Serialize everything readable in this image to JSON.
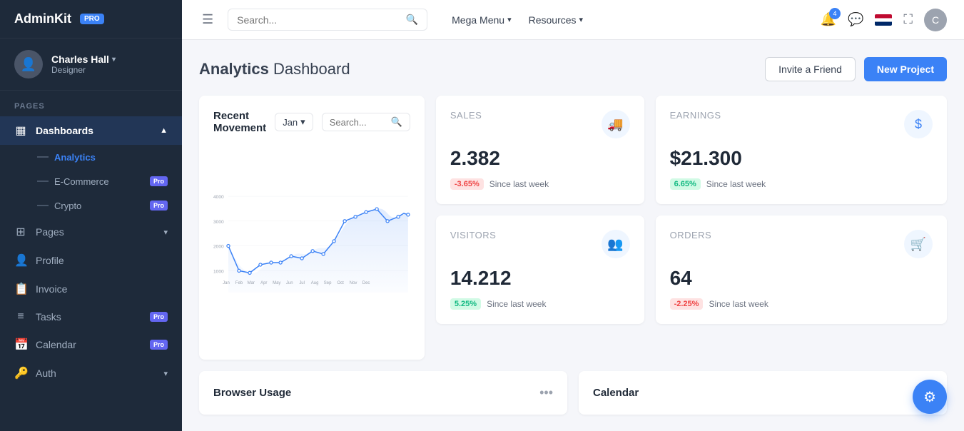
{
  "brand": {
    "name": "AdminKit",
    "badge": "PRO"
  },
  "user": {
    "name": "Charles Hall",
    "role": "Designer",
    "avatar_initial": "C"
  },
  "sidebar": {
    "pages_label": "Pages",
    "groups": [
      {
        "label": "Dashboards",
        "icon": "▦",
        "expanded": true,
        "sub_items": [
          {
            "label": "Analytics",
            "active": true,
            "pro": false
          },
          {
            "label": "E-Commerce",
            "active": false,
            "pro": true
          },
          {
            "label": "Crypto",
            "active": false,
            "pro": true
          }
        ]
      }
    ],
    "items": [
      {
        "label": "Pages",
        "icon": "⊞",
        "pro": false,
        "has_arrow": true
      },
      {
        "label": "Profile",
        "icon": "👤",
        "pro": false
      },
      {
        "label": "Invoice",
        "icon": "📋",
        "pro": false
      },
      {
        "label": "Tasks",
        "icon": "≡",
        "pro": true
      },
      {
        "label": "Calendar",
        "icon": "📅",
        "pro": true
      },
      {
        "label": "Auth",
        "icon": "🔑",
        "pro": false,
        "has_arrow": true
      }
    ]
  },
  "topbar": {
    "search_placeholder": "Search...",
    "mega_menu": "Mega Menu",
    "resources": "Resources",
    "notification_count": "4"
  },
  "page": {
    "title_strong": "Analytics",
    "title_rest": " Dashboard",
    "invite_button": "Invite a Friend",
    "new_project_button": "New Project"
  },
  "stats": {
    "sales": {
      "label": "Sales",
      "value": "2.382",
      "badge": "-3.65%",
      "badge_type": "neg",
      "since": "Since last week",
      "icon": "🚚"
    },
    "earnings": {
      "label": "Earnings",
      "value": "$21.300",
      "badge": "6.65%",
      "badge_type": "pos",
      "since": "Since last week",
      "icon": "$"
    },
    "visitors": {
      "label": "Visitors",
      "value": "14.212",
      "badge": "5.25%",
      "badge_type": "pos",
      "since": "Since last week",
      "icon": "👥"
    },
    "orders": {
      "label": "Orders",
      "value": "64",
      "badge": "-2.25%",
      "badge_type": "neg",
      "since": "Since last week",
      "icon": "🛒"
    }
  },
  "chart": {
    "title": "Recent Movement",
    "month": "Jan",
    "search_placeholder": "Search...",
    "y_labels": [
      "4000",
      "3000",
      "2000",
      "1000"
    ],
    "x_labels": [
      "Jan",
      "Feb",
      "Mar",
      "Apr",
      "May",
      "Jun",
      "Jul",
      "Aug",
      "Sep",
      "Oct",
      "Nov",
      "Dec"
    ]
  },
  "bottom": {
    "browser_usage": {
      "title": "Browser Usage",
      "dots": "..."
    },
    "calendar": {
      "title": "Calendar",
      "dots": "..."
    }
  },
  "fab": {
    "icon": "⚙"
  }
}
